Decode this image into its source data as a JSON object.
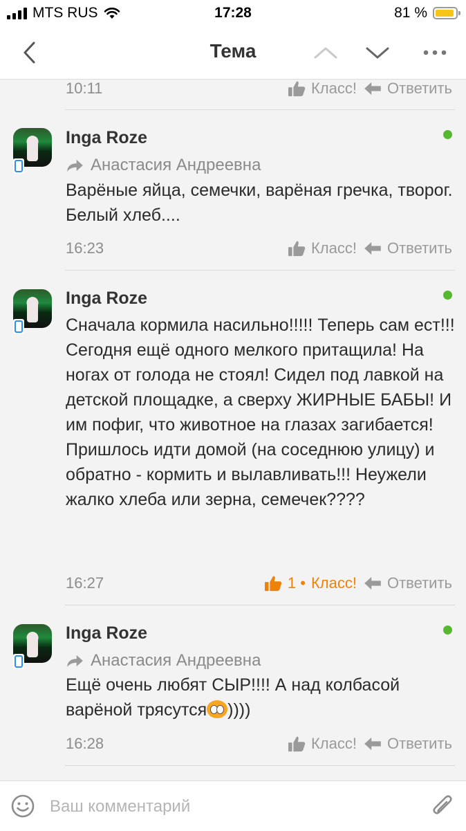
{
  "status_bar": {
    "carrier": "MTS RUS",
    "time": "17:28",
    "battery": "81 %"
  },
  "nav": {
    "title": "Тема",
    "icons": [
      "back-icon",
      "chevron-up-icon",
      "chevron-down-icon",
      "more-icon"
    ]
  },
  "actions": {
    "like_label": "Класс!",
    "reply_label": "Ответить"
  },
  "posts": [
    {
      "time": "10:11"
    },
    {
      "author": "Inga Roze",
      "reply_to": "Анастасия Андреевна",
      "text": "Варёные яйца, семечки, варёная гречка, творог. Белый хлеб....",
      "time": "16:23"
    },
    {
      "author": "Inga Roze",
      "text": "Сначала кормила насильно!!!!! Теперь сам ест!!! Сегодня ещё одного мелкого притащила! На ногах от голода не стоял! Сидел под лавкой на детской площадке, а сверху ЖИРНЫЕ БАБЫ! И им пофиг, что животное на глазах загибается! Пришлось идти домой (на соседнюю улицу) и обратно - кормить и вылавливать!!! Неужели жалко хлеба или зерна, семечек????",
      "time": "16:27",
      "likes": "1 •",
      "liked": true
    },
    {
      "author": "Inga Roze",
      "reply_to": "Анастасия Андреевна",
      "text": "Ещё очень любят СЫР!!!! А над колбасой варёной трясутся",
      "text_tail": "))))",
      "time": "16:28"
    }
  ],
  "comment": {
    "placeholder": "Ваш комментарий"
  },
  "colors": {
    "accent": "#ee8208",
    "online": "#56b82e",
    "mobile": "#2c8ef0",
    "muted": "#9a9a9a"
  }
}
